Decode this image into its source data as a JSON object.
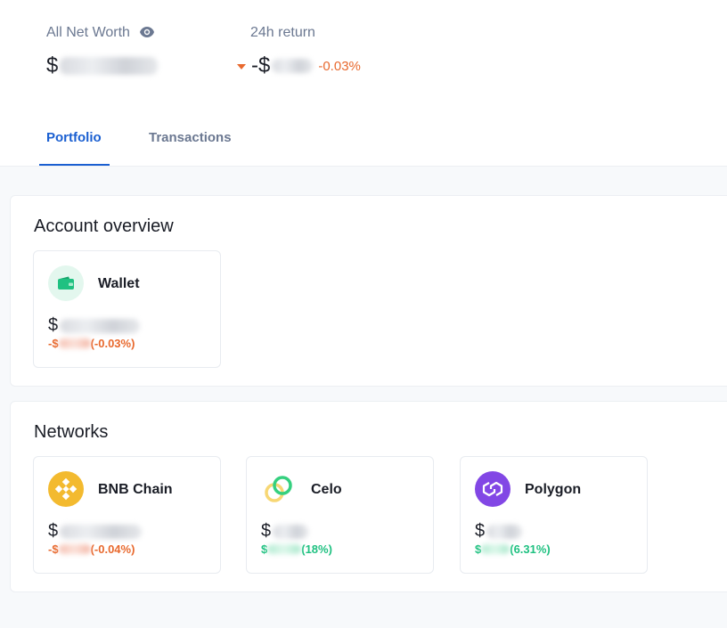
{
  "header": {
    "net_worth_label": "All Net Worth",
    "net_worth_currency": "$",
    "return_label": "24h return",
    "return_sign": "-$",
    "return_pct": "-0.03%"
  },
  "tabs": [
    {
      "label": "Portfolio",
      "active": true
    },
    {
      "label": "Transactions",
      "active": false
    }
  ],
  "account_overview": {
    "title": "Account overview",
    "wallet": {
      "name": "Wallet",
      "icon": "wallet-icon",
      "currency": "$",
      "change_sign": "-$",
      "change_pct": "(-0.03%)"
    }
  },
  "networks": {
    "title": "Networks",
    "items": [
      {
        "name": "BNB Chain",
        "icon": "bnb-chain-icon",
        "currency": "$",
        "change_sign": "-$",
        "change_pct": "(-0.04%)",
        "direction": "down"
      },
      {
        "name": "Celo",
        "icon": "celo-icon",
        "currency": "$",
        "change_sign": "$",
        "change_pct": "(18%)",
        "direction": "up"
      },
      {
        "name": "Polygon",
        "icon": "polygon-icon",
        "currency": "$",
        "change_sign": "$",
        "change_pct": "(6.31%)",
        "direction": "up"
      }
    ]
  },
  "colors": {
    "accent": "#1a5fd1",
    "negative": "#e8692e",
    "positive": "#1fc181",
    "wallet_icon": "#1fc181",
    "bnb": "#f3ba2f",
    "polygon": "#8247e5"
  }
}
